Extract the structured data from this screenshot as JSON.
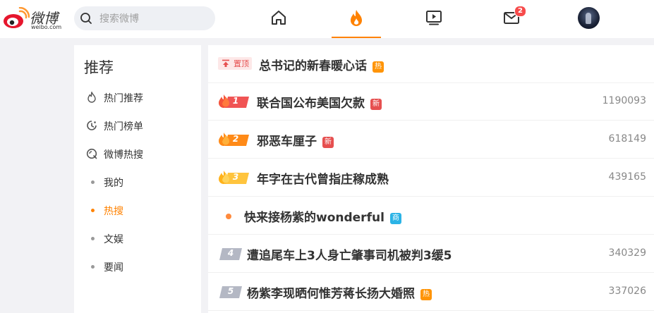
{
  "header": {
    "logo_text": "微博",
    "logo_sub": "weibo.com",
    "search_placeholder": "搜索微博",
    "message_badge": "2"
  },
  "sidebar": {
    "title": "推荐",
    "items": [
      {
        "label": "热门推荐",
        "icon": "fire-outline-icon"
      },
      {
        "label": "热门榜单",
        "icon": "clock-rank-icon"
      },
      {
        "label": "微博热搜",
        "icon": "search-circle-icon"
      },
      {
        "label": "我的",
        "icon": "dot"
      },
      {
        "label": "热搜",
        "icon": "dot",
        "active": true
      },
      {
        "label": "文娱",
        "icon": "dot"
      },
      {
        "label": "要闻",
        "icon": "dot"
      }
    ]
  },
  "hot_list": [
    {
      "rank": "置顶",
      "title": "总书记的新春暖心话",
      "tag": "热",
      "count": ""
    },
    {
      "rank": "1",
      "title": "联合国公布美国欠款",
      "tag": "新",
      "count": "1190093"
    },
    {
      "rank": "2",
      "title": "邪恶车厘子",
      "tag": "新",
      "count": "618149"
    },
    {
      "rank": "3",
      "title": "年字在古代曾指庄稼成熟",
      "tag": "",
      "count": "439165"
    },
    {
      "rank": "",
      "title": "快来接杨紫的wonderful",
      "tag": "商",
      "count": ""
    },
    {
      "rank": "4",
      "title": "遭追尾车上3人身亡肇事司机被判3缓5",
      "tag": "",
      "count": "340329"
    },
    {
      "rank": "5",
      "title": "杨紫李现晒何惟芳蒋长扬大婚照",
      "tag": "热",
      "count": "337026"
    }
  ],
  "colors": {
    "accent": "#ff8200",
    "tag_hot": "#ff9406",
    "tag_new": "#e64f4f",
    "tag_ad": "#2bb3e6"
  }
}
